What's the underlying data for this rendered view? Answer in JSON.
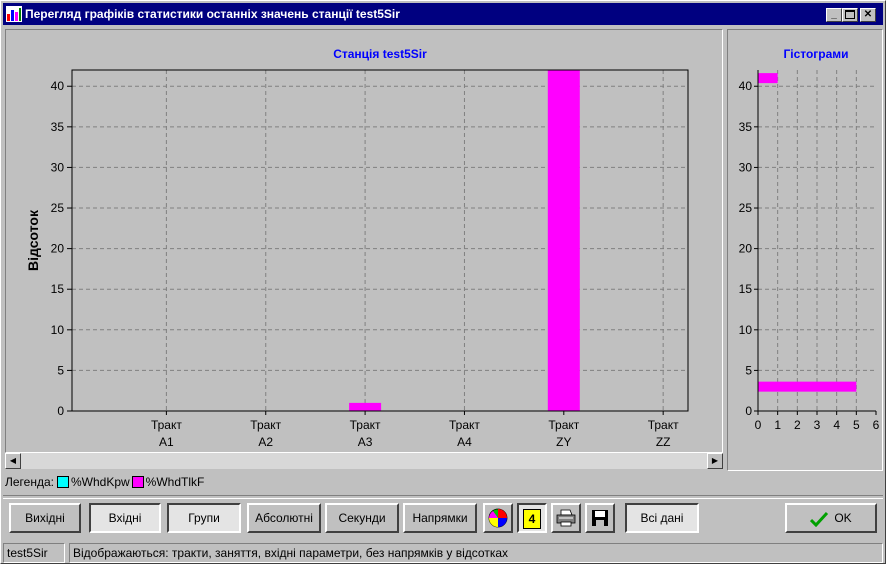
{
  "window": {
    "title": "Перегляд графіків статистики останніх значень станції test5Sir"
  },
  "chart_data": [
    {
      "type": "bar",
      "title": "Станція test5Sir",
      "ylabel": "Відсоток",
      "xlabel": "",
      "ylim": [
        0,
        42
      ],
      "yticks": [
        0,
        5,
        10,
        15,
        20,
        25,
        30,
        35,
        40
      ],
      "categories": [
        {
          "line1": "Тракт",
          "line2": "A1"
        },
        {
          "line1": "Тракт",
          "line2": "A2"
        },
        {
          "line1": "Тракт",
          "line2": "A3"
        },
        {
          "line1": "Тракт",
          "line2": "A4"
        },
        {
          "line1": "Тракт",
          "line2": "ZY"
        },
        {
          "line1": "Тракт",
          "line2": "ZZ"
        }
      ],
      "series": [
        {
          "name": "%WhdKpw",
          "color": "#00ffff",
          "values": [
            0,
            0,
            0,
            0,
            0,
            0
          ]
        },
        {
          "name": "%WhdTlkF",
          "color": "#ff00ff",
          "values": [
            0,
            0,
            1,
            0,
            42,
            0
          ]
        }
      ],
      "grid": true
    },
    {
      "type": "bar",
      "orientation": "horizontal",
      "title": "Гістограми",
      "xlim": [
        0,
        6
      ],
      "xticks": [
        0,
        1,
        2,
        3,
        4,
        5,
        6
      ],
      "ylim": [
        0,
        42
      ],
      "yticks": [
        0,
        5,
        10,
        15,
        20,
        25,
        30,
        35,
        40
      ],
      "bars": [
        {
          "y": 41,
          "length": 1,
          "color": "#ff00ff"
        },
        {
          "y": 3,
          "length": 5,
          "color": "#ff00ff"
        }
      ],
      "grid": true
    }
  ],
  "legend": {
    "label": "Легенда:",
    "items": [
      {
        "name": "%WhdKpw",
        "color": "#00ffff"
      },
      {
        "name": "%WhdTlkF",
        "color": "#ff00ff"
      }
    ]
  },
  "toolbar": {
    "outgoing": "Вихідні",
    "incoming": "Вхідні",
    "groups": "Групи",
    "absolute": "Абсолютні",
    "seconds": "Секунди",
    "directions": "Напрямки",
    "counter": "4",
    "all_data": "Всі дані",
    "ok": "OK",
    "icons": [
      "pie-chart-icon",
      "counter-icon",
      "printer-icon",
      "save-icon",
      "checkmark-icon"
    ]
  },
  "statusbar": {
    "station": "test5Sir",
    "message": "Відображаються: тракти, заняття, вхідні параметри, без напрямків у відсотках"
  },
  "colors": {
    "titlebar": "#000080",
    "chart_title": "#0000ff",
    "bar": "#ff00ff",
    "ok_check": "#00a000"
  }
}
